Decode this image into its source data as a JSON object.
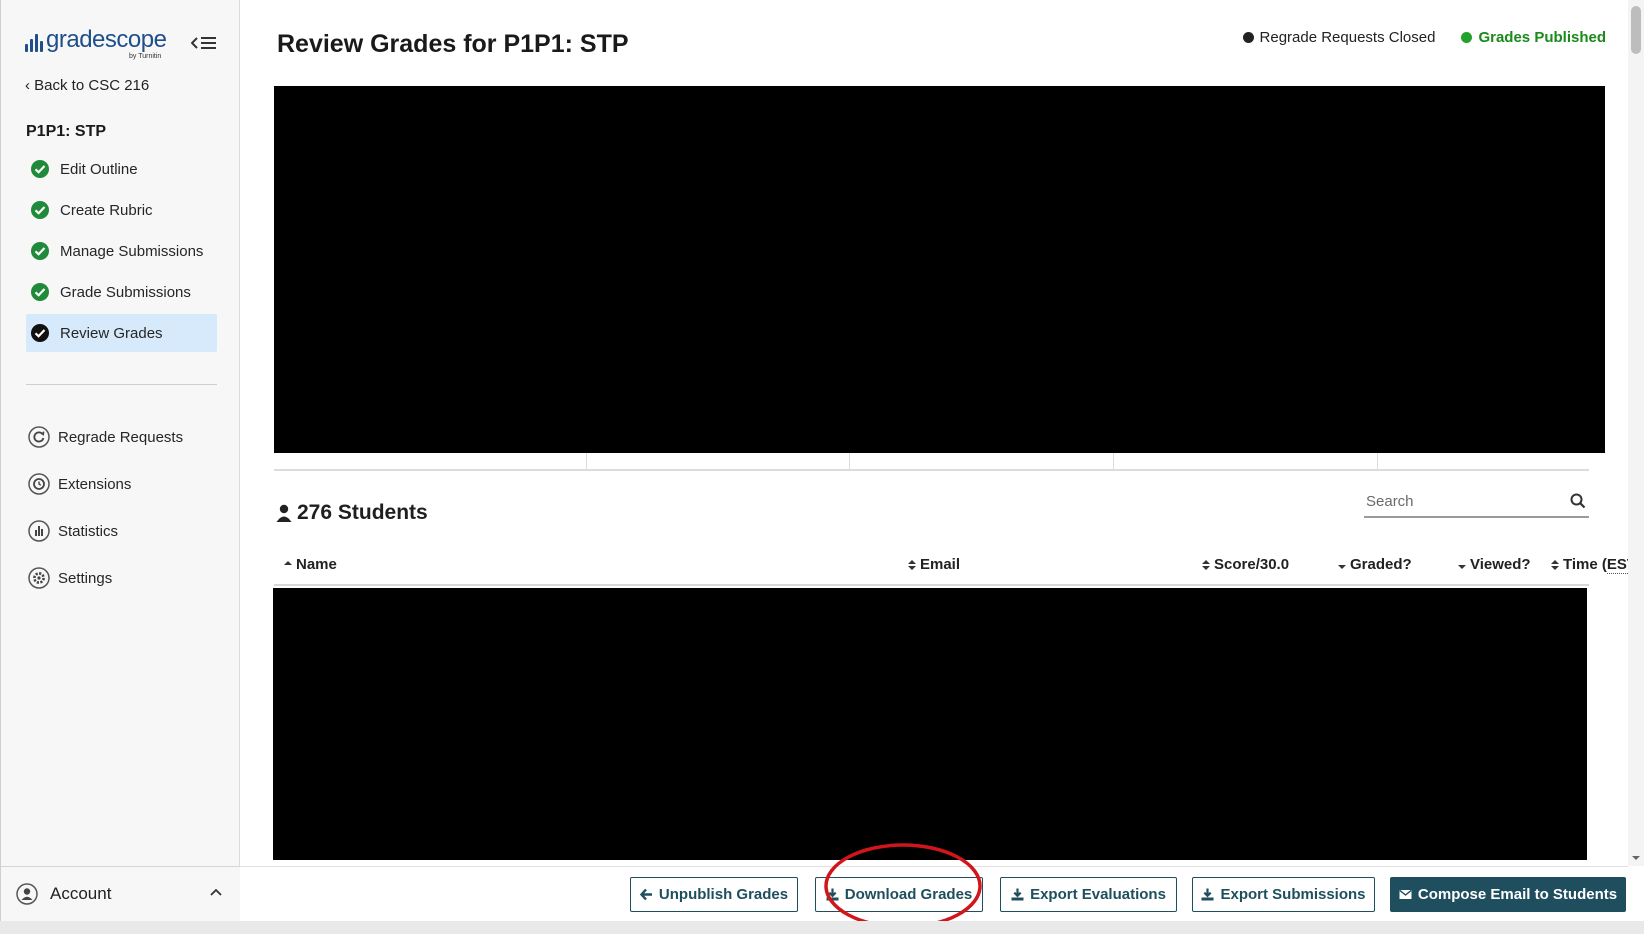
{
  "sidebar": {
    "logo_text": "gradescope",
    "logo_sub": "by Turnitin",
    "back_link": "Back to CSC 216",
    "assignment_title": "P1P1: STP",
    "steps": [
      {
        "label": "Edit Outline"
      },
      {
        "label": "Create Rubric"
      },
      {
        "label": "Manage Submissions"
      },
      {
        "label": "Grade Submissions"
      },
      {
        "label": "Review Grades",
        "active": true
      }
    ],
    "tools": [
      {
        "label": "Regrade Requests",
        "icon": "refresh-icon"
      },
      {
        "label": "Extensions",
        "icon": "clock-icon"
      },
      {
        "label": "Statistics",
        "icon": "bar-chart-icon"
      },
      {
        "label": "Settings",
        "icon": "gear-icon"
      }
    ],
    "account_label": "Account"
  },
  "header": {
    "title": "Review Grades for P1P1: STP",
    "status_regrade": "Regrade Requests Closed",
    "status_grades": "Grades Published"
  },
  "students": {
    "count_label": "276 Students",
    "search_placeholder": "Search"
  },
  "table": {
    "columns": [
      {
        "label": "Name",
        "sort": "asc"
      },
      {
        "label": "Email",
        "sort": "both"
      },
      {
        "label": "Score/30.0",
        "sort": "both"
      },
      {
        "label": "Graded?",
        "sort": "desc"
      },
      {
        "label": "Viewed?",
        "sort": "desc"
      },
      {
        "label_prefix": "Time (",
        "label_abbr": "EST",
        "label_suffix": ")",
        "sort": "both"
      }
    ]
  },
  "toolbar": {
    "unpublish": "Unpublish Grades",
    "download": "Download Grades",
    "export_evaluations": "Export Evaluations",
    "export_submissions": "Export Submissions",
    "compose_email": "Compose Email to Students"
  },
  "colors": {
    "brand": "#1f4f8a",
    "button": "#1f4f5e",
    "published": "#1a8a1a",
    "check_green": "#1f8a3a",
    "active_bg": "#d6eafb",
    "highlight_ring": "#d0161b"
  }
}
